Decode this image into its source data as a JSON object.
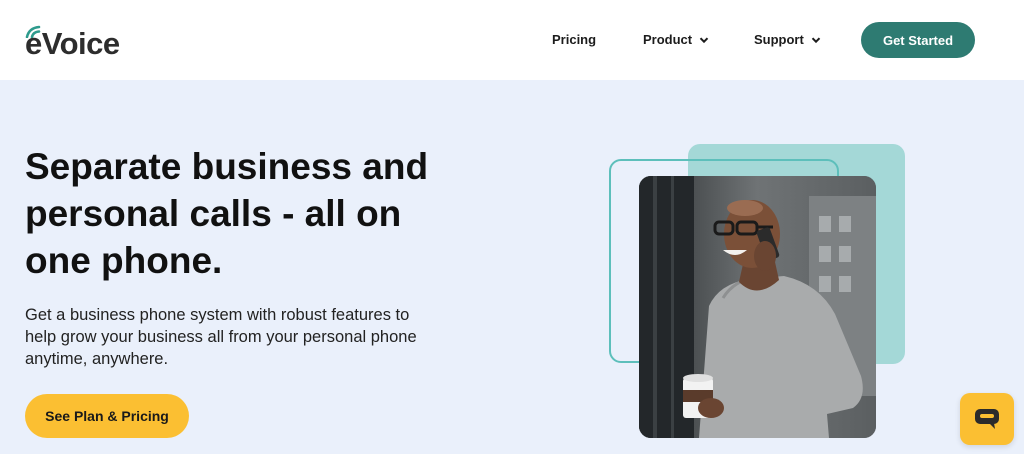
{
  "header": {
    "logo_text": "eVoice",
    "nav": {
      "pricing": "Pricing",
      "product": "Product",
      "support": "Support"
    },
    "cta_label": "Get Started"
  },
  "hero": {
    "title": "Separate business and personal calls - all on one phone.",
    "subtitle": "Get a business phone system with robust features to help grow your business all from your personal phone anytime, anywhere.",
    "cta_label": "See Plan & Pricing",
    "image": "man-on-phone-photo"
  },
  "chat_widget": {
    "icon": "chat-bubble-icon"
  },
  "colors": {
    "brand_teal": "#2e7b72",
    "accent_yellow": "#fbbf32",
    "hero_background": "#eaf0fb",
    "decor_teal": "#a4d8d7"
  }
}
